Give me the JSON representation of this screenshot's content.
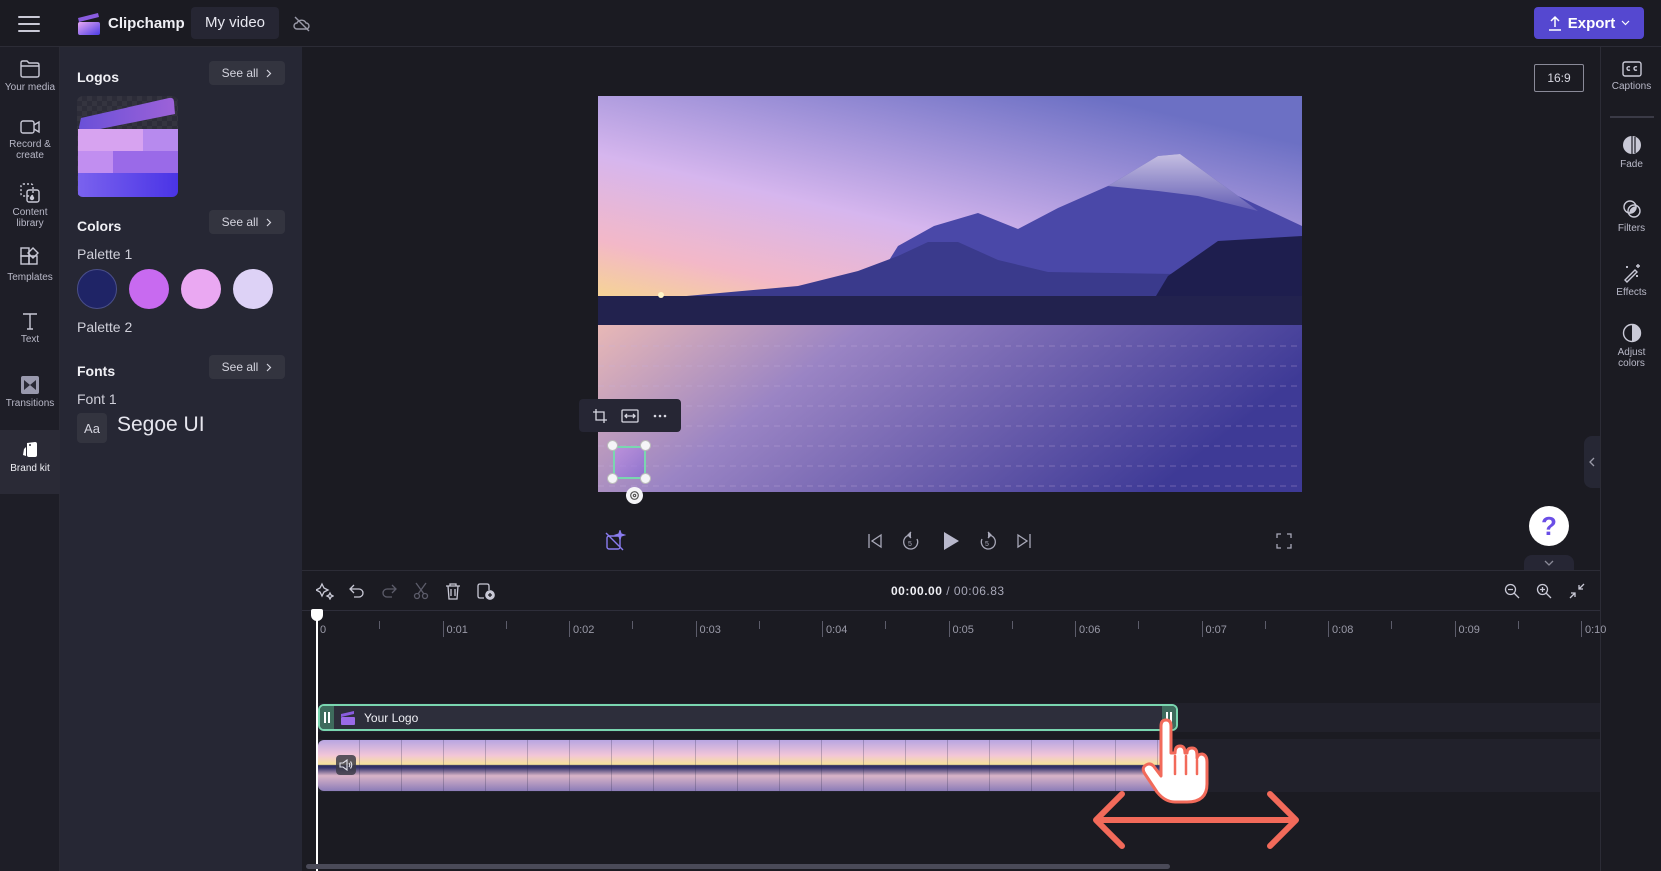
{
  "app": {
    "name": "Clipchamp",
    "project_title": "My video",
    "export_label": "Export",
    "aspect_ratio": "16:9"
  },
  "left_nav": {
    "items": [
      {
        "label": "Your media",
        "icon": "folder-icon"
      },
      {
        "label": "Record & create",
        "icon": "camera-icon"
      },
      {
        "label": "Content library",
        "icon": "content-library-icon"
      },
      {
        "label": "Templates",
        "icon": "templates-icon"
      },
      {
        "label": "Text",
        "icon": "text-icon"
      },
      {
        "label": "Transitions",
        "icon": "transitions-icon"
      },
      {
        "label": "Brand kit",
        "icon": "brand-kit-icon",
        "active": true
      }
    ]
  },
  "brand_panel": {
    "logos_title": "Logos",
    "colors_title": "Colors",
    "fonts_title": "Fonts",
    "see_all_label": "See all",
    "palette1_label": "Palette 1",
    "palette2_label": "Palette 2",
    "palette1_colors": [
      "#1f2466",
      "#c86af0",
      "#eaa8f2",
      "#ddd2f6"
    ],
    "font1_label": "Font 1",
    "font_preview": "Aa",
    "font1_name": "Segoe UI"
  },
  "right_sidebar": {
    "items": [
      {
        "label": "Captions",
        "icon": "captions-icon"
      },
      {
        "label": "Fade",
        "icon": "fade-icon"
      },
      {
        "label": "Filters",
        "icon": "filters-icon"
      },
      {
        "label": "Effects",
        "icon": "effects-icon"
      },
      {
        "label": "Adjust colors",
        "icon": "adjust-colors-icon"
      }
    ]
  },
  "help": {
    "label": "?"
  },
  "timeline": {
    "current_time": "00:00.00",
    "separator": " / ",
    "total_time": "00:06.83",
    "ruler_labels": [
      "0",
      "0:01",
      "0:02",
      "0:03",
      "0:04",
      "0:05",
      "0:06",
      "0:07",
      "0:08",
      "0:09",
      "0:10"
    ],
    "logo_clip_name": "Your Logo"
  },
  "colors": {
    "accent": "#5548d0",
    "selection": "#7ad6b0",
    "annotation": "#f26a5a"
  }
}
